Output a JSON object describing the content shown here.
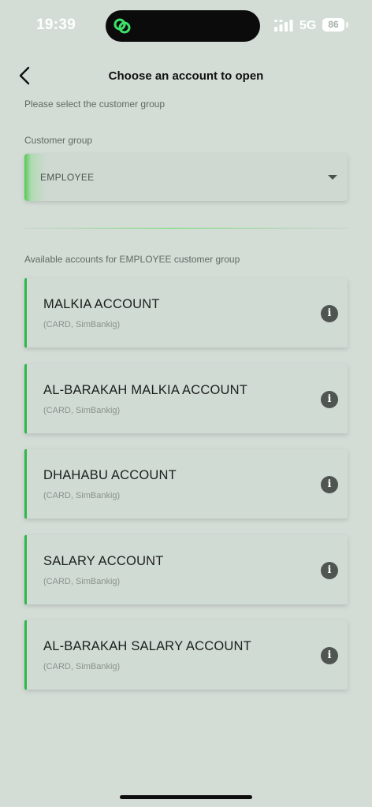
{
  "status_bar": {
    "time": "19:39",
    "network": "5G",
    "battery": "86"
  },
  "header": {
    "title": "Choose an account to open"
  },
  "instruction": "Please select the customer group",
  "customer_group": {
    "label": "Customer group",
    "selected": "EMPLOYEE"
  },
  "available_label": "Available accounts for  EMPLOYEE customer group",
  "accounts": [
    {
      "name": "MALKIA ACCOUNT",
      "sub": "(CARD, SimBankig)"
    },
    {
      "name": "AL-BARAKAH MALKIA ACCOUNT",
      "sub": "(CARD, SimBankig)"
    },
    {
      "name": "DHAHABU ACCOUNT",
      "sub": "(CARD, SimBankig)"
    },
    {
      "name": "SALARY ACCOUNT",
      "sub": "(CARD, SimBankig)"
    },
    {
      "name": "AL-BARAKAH SALARY ACCOUNT",
      "sub": "(CARD, SimBankig)"
    }
  ],
  "icons": {
    "info": "i",
    "accent_color": "#2fb84a"
  }
}
